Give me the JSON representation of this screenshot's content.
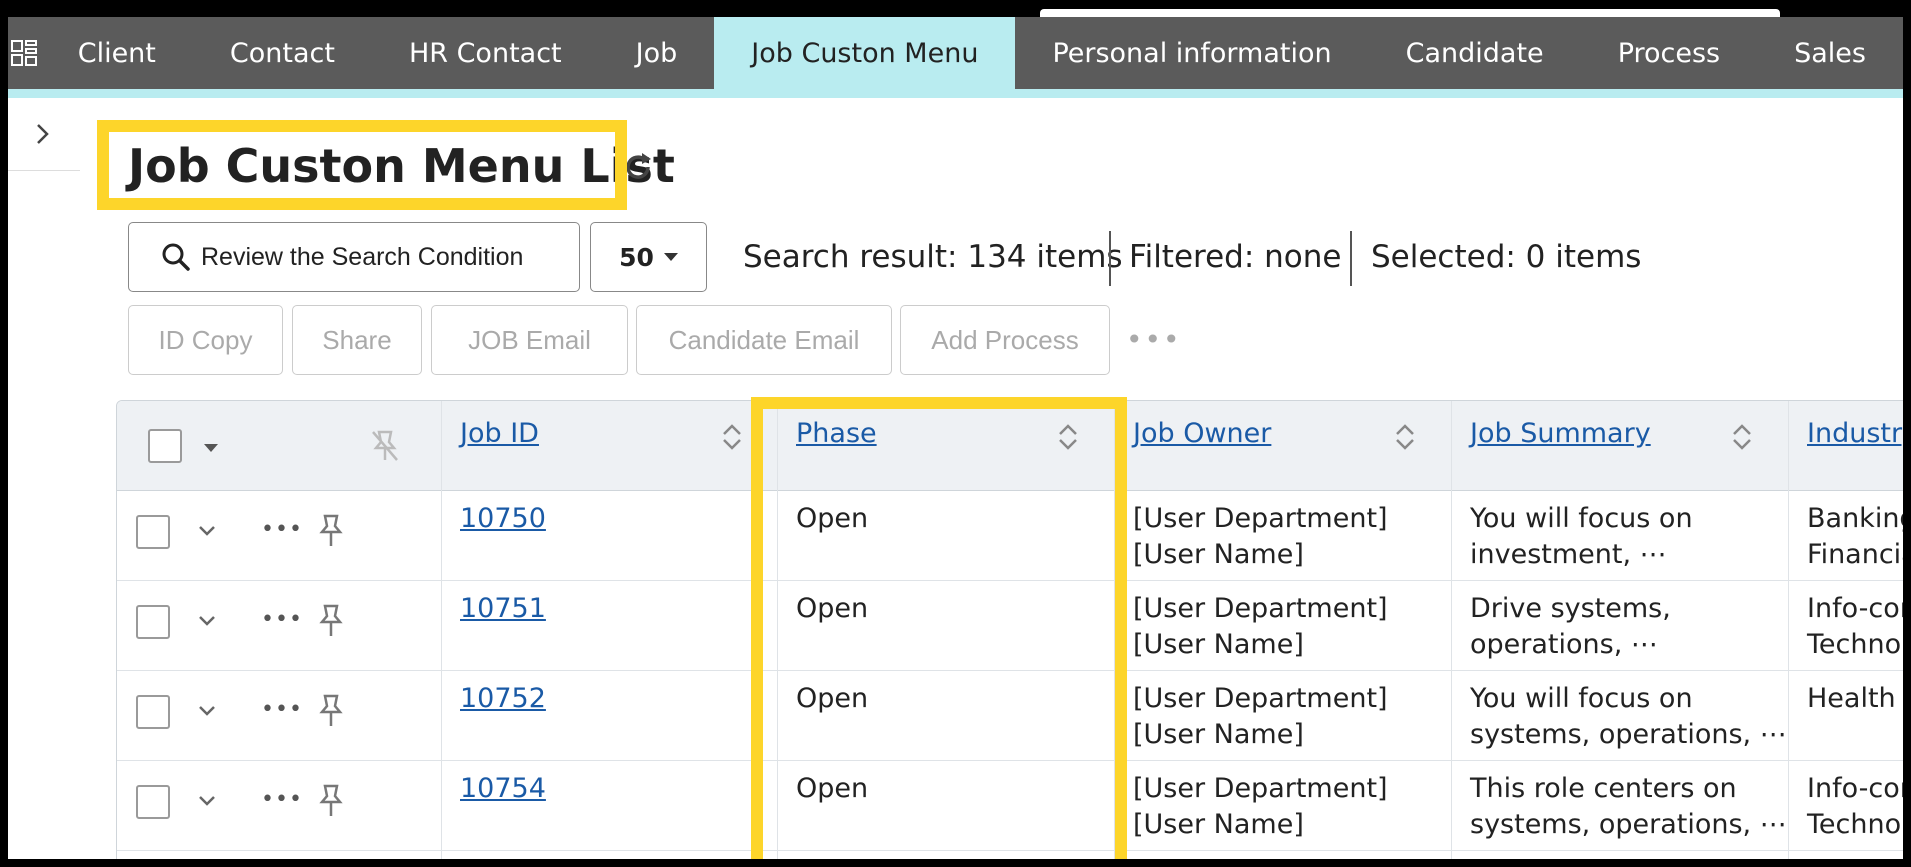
{
  "nav": {
    "items": [
      "Client",
      "Contact",
      "HR Contact",
      "Job",
      "Job Custon Menu",
      "Personal information",
      "Candidate",
      "Process",
      "Sales"
    ],
    "active": "Job Custon Menu"
  },
  "page": {
    "title": "Job Custon Menu List"
  },
  "search": {
    "review_label": "Review the Search Condition",
    "page_size": "50",
    "result": "Search result: 134 items",
    "filtered": "Filtered: none",
    "selected": "Selected:  0 items"
  },
  "actions": [
    "ID Copy",
    "Share",
    "JOB Email",
    "Candidate Email",
    "Add Process"
  ],
  "table": {
    "columns": [
      "Job ID",
      "Phase",
      "Job Owner",
      "Job Summary",
      "Industry"
    ],
    "rows": [
      {
        "job_id": "10750",
        "phase": "Open",
        "owner1": "[User Department]",
        "owner2": "[User Name]",
        "summary1": "You will focus on",
        "summary2": "investment, ⋯",
        "industry1": "Banking",
        "industry2": "Financia"
      },
      {
        "job_id": "10751",
        "phase": "Open",
        "owner1": "[User Department]",
        "owner2": "[User Name]",
        "summary1": "Drive systems,",
        "summary2": "operations, ⋯",
        "industry1": "Info-con",
        "industry2": "Technolo"
      },
      {
        "job_id": "10752",
        "phase": "Open",
        "owner1": "[User Department]",
        "owner2": "[User Name]",
        "summary1": "You will focus on",
        "summary2": "systems, operations, ⋯",
        "industry1": "Health &",
        "industry2": ""
      },
      {
        "job_id": "10754",
        "phase": "Open",
        "owner1": "[User Department]",
        "owner2": "[User Name]",
        "summary1": "This role centers on",
        "summary2": "systems, operations, ⋯",
        "industry1": "Info-con",
        "industry2": "Technolo"
      }
    ]
  },
  "colors": {
    "nav_bg": "#5b5b5b",
    "nav_active": "#b9ecf0",
    "highlight": "#fdd52a",
    "link": "#1a5aa6"
  },
  "icons": [
    "apps-grid-icon",
    "chevron-right-icon",
    "refresh-icon",
    "search-icon",
    "caret-down-icon",
    "more-horizontal-icon",
    "sort-icon",
    "unpin-icon",
    "chevron-down-icon",
    "pin-icon"
  ]
}
